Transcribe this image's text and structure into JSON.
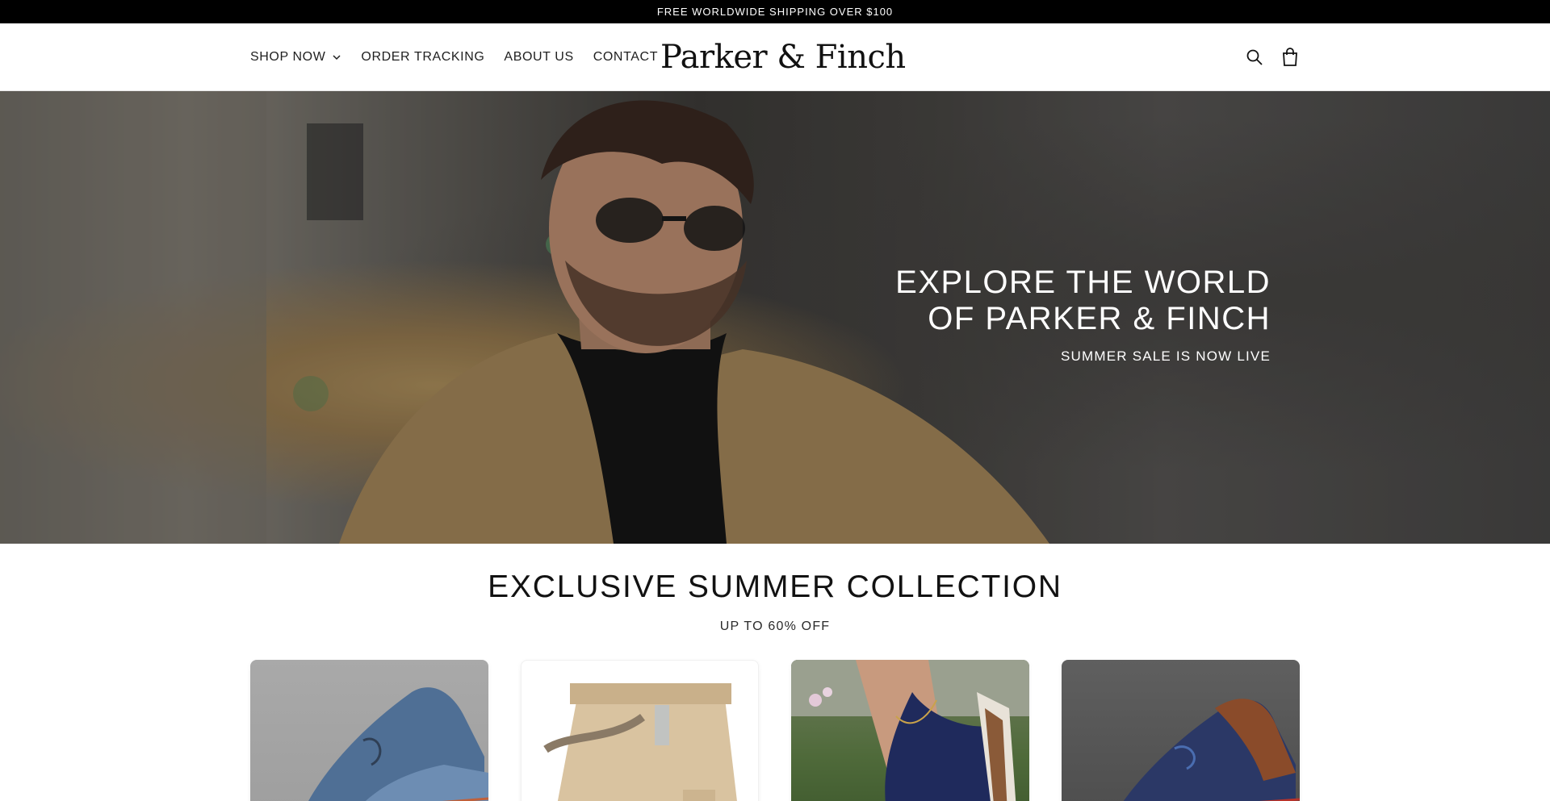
{
  "announcement": {
    "text": "FREE WORLDWIDE SHIPPING OVER $100"
  },
  "header": {
    "nav": [
      {
        "label": "SHOP NOW",
        "has_dropdown": true
      },
      {
        "label": "ORDER TRACKING"
      },
      {
        "label": "ABOUT US"
      },
      {
        "label": "CONTACT"
      }
    ],
    "logo": "Parker & Finch",
    "icons": [
      "search-icon",
      "cart-icon"
    ]
  },
  "hero": {
    "title_line1": "EXPLORE THE WORLD",
    "title_line2": "OF PARKER & FINCH",
    "subtitle": "SUMMER SALE IS NOW LIVE"
  },
  "collection": {
    "title": "EXCLUSIVE SUMMER COLLECTION",
    "subtitle": "UP TO 60% OFF",
    "products": [
      {
        "image": "blue-sneaker"
      },
      {
        "image": "khaki-cargo-shorts"
      },
      {
        "image": "navy-strap-sandal"
      },
      {
        "image": "navy-brown-knit-shoe"
      }
    ]
  },
  "colors": {
    "announcement_bg": "#000000",
    "text": "#121212",
    "hero_text": "#ffffff"
  }
}
